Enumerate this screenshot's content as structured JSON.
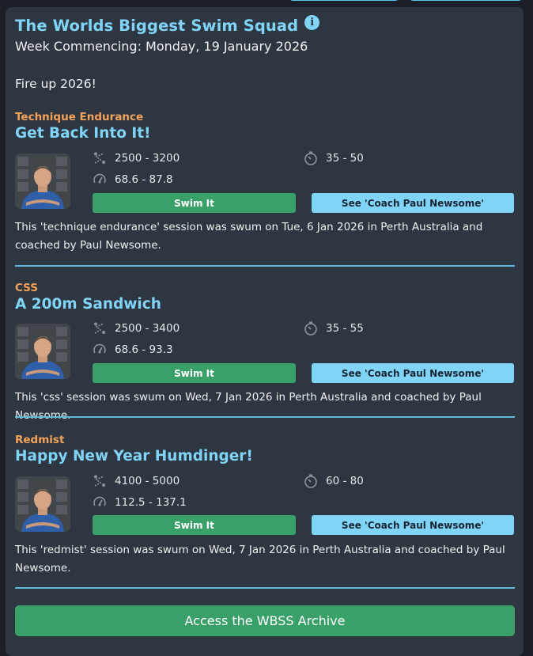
{
  "header": {
    "title": "The Worlds Biggest Swim Squad",
    "info_icon": "i",
    "week": "Week Commencing: Monday, 19 January 2026",
    "intro": "Fire up 2026!"
  },
  "sessions": [
    {
      "type": "Technique Endurance",
      "name": "Get Back Into It!",
      "distance": "2500 - 3200",
      "time": "35 - 50",
      "pace": "68.6 - 87.8",
      "swim_label": "Swim It",
      "coach_label": "See 'Coach Paul Newsome'",
      "description": "This 'technique endurance' session was swum on Tue, 6 Jan 2026 in Perth Australia and coached by Paul Newsome."
    },
    {
      "type": "CSS",
      "name": "A 200m Sandwich",
      "distance": "2500 - 3400",
      "time": "35 - 55",
      "pace": "68.6 - 93.3",
      "swim_label": "Swim It",
      "coach_label": "See 'Coach Paul Newsome'",
      "description": "This 'css' session was swum on Wed, 7 Jan 2026 in Perth Australia and coached by Paul Newsome."
    },
    {
      "type": "Redmist",
      "name": "Happy New Year Humdinger!",
      "distance": "4100 - 5000",
      "time": "60 - 80",
      "pace": "112.5 - 137.1",
      "swim_label": "Swim It",
      "coach_label": "See 'Coach Paul Newsome'",
      "description": "This 'redmist' session was swum on Wed, 7 Jan 2026 in Perth Australia and coached by Paul Newsome."
    }
  ],
  "archive_label": "Access the WBSS Archive",
  "icons": {
    "distance": "route-icon",
    "time": "stopwatch-icon",
    "pace": "speed-icon",
    "info": "info-icon"
  },
  "colors": {
    "accent_blue": "#7fd4f7",
    "accent_orange": "#f5a25a",
    "green": "#3aa06a",
    "card": "#2d3641"
  }
}
